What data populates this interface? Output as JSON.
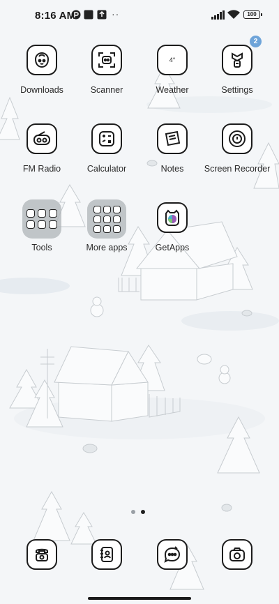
{
  "status_bar": {
    "time": "8:16 AM",
    "battery": "100",
    "notification_icons": [
      "p-icon",
      "square-icon",
      "upload-icon"
    ],
    "more": "··"
  },
  "apps": {
    "row1": [
      {
        "label": "Downloads",
        "icon": "downloads-icon"
      },
      {
        "label": "Scanner",
        "icon": "scanner-icon"
      },
      {
        "label": "Weather",
        "icon": "weather-icon",
        "icon_text": "4°"
      },
      {
        "label": "Settings",
        "icon": "settings-icon",
        "badge": "2"
      }
    ],
    "row2": [
      {
        "label": "FM Radio",
        "icon": "radio-icon"
      },
      {
        "label": "Calculator",
        "icon": "calculator-icon"
      },
      {
        "label": "Notes",
        "icon": "notes-icon"
      },
      {
        "label": "Screen Recorder",
        "icon": "screen-recorder-icon"
      }
    ],
    "row3": [
      {
        "label": "Tools",
        "icon": "folder-icon"
      },
      {
        "label": "More apps",
        "icon": "folder-icon"
      },
      {
        "label": "GetApps",
        "icon": "getapps-icon"
      }
    ]
  },
  "dock": [
    {
      "icon": "phone-icon"
    },
    {
      "icon": "contacts-icon"
    },
    {
      "icon": "messages-icon"
    },
    {
      "icon": "camera-icon"
    }
  ],
  "page_indicator": {
    "pages": 2,
    "current": 2
  },
  "colors": {
    "badge": "#6ea4d9",
    "background": "#f4f6f8",
    "icon_outline": "#1c1c1c"
  }
}
